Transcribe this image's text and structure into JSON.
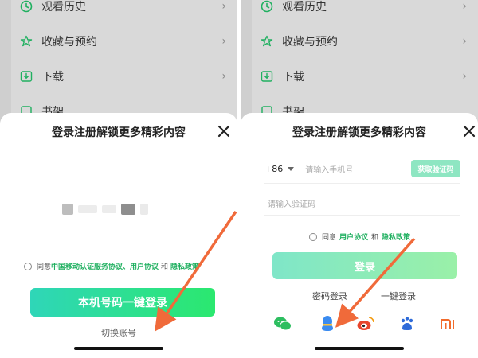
{
  "menu": {
    "items": [
      {
        "label": "观看历史",
        "icon": "clock-icon"
      },
      {
        "label": "收藏与预约",
        "icon": "star-icon"
      },
      {
        "label": "下载",
        "icon": "download-icon"
      },
      {
        "label": "书架",
        "icon": "bookshelf-icon"
      }
    ]
  },
  "left_sheet": {
    "title": "登录注册解锁更多精彩内容",
    "agreement": {
      "prefix": "同意",
      "link1": "中国移动认证服务协议、用户协议",
      "and": "和",
      "link2": "隐私政策"
    },
    "primary_button": "本机号码一键登录",
    "switch_account": "切换账号"
  },
  "right_sheet": {
    "title": "登录注册解锁更多精彩内容",
    "country_code": "+86",
    "phone_placeholder": "请输入手机号",
    "get_code_button": "获取验证码",
    "code_placeholder": "请输入验证码",
    "agreement": {
      "prefix": "同意",
      "link1": "用户协议",
      "and": "和",
      "link2": "隐私政策"
    },
    "login_button": "登录",
    "password_login": "密码登录",
    "onekey_login": "一键登录",
    "social_logins": [
      "wechat-icon",
      "qq-icon",
      "weibo-icon",
      "baidu-icon",
      "xiaomi-icon"
    ]
  },
  "colors": {
    "accent_green": "#20b060",
    "arrow": "#f06a3a",
    "primary_gradient_start": "#2fd6b8",
    "primary_gradient_end": "#2be86f"
  }
}
